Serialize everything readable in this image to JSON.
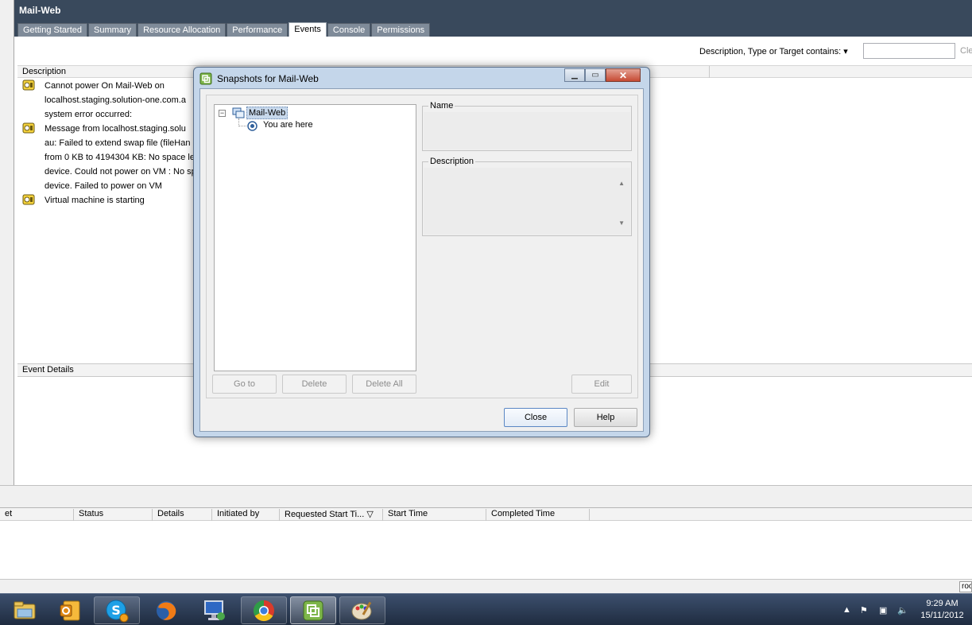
{
  "window": {
    "title": "Mail-Web",
    "tabs": [
      {
        "label": "Getting Started",
        "active": false
      },
      {
        "label": "Summary",
        "active": false
      },
      {
        "label": "Resource Allocation",
        "active": false
      },
      {
        "label": "Performance",
        "active": false
      },
      {
        "label": "Events",
        "active": true
      },
      {
        "label": "Console",
        "active": false
      },
      {
        "label": "Permissions",
        "active": false
      }
    ]
  },
  "filter": {
    "label": "Description, Type or Target contains: ▾",
    "value": "",
    "clear_label": "Cle"
  },
  "events": {
    "column_header": "Description",
    "items": [
      {
        "lines": [
          "Cannot power On Mail-Web on",
          "localhost.staging.solution-one.com.a",
          "system error occurred:"
        ]
      },
      {
        "lines": [
          "Message from localhost.staging.solu",
          "au: Failed to extend swap file (fileHan",
          "from 0 KB to 4194304 KB: No space le",
          "device. Could not power on VM : No sp",
          "device. Failed to power on VM"
        ]
      },
      {
        "lines": [
          "Virtual machine is starting"
        ]
      }
    ]
  },
  "event_details": {
    "header": "Event Details"
  },
  "tasks": {
    "columns": [
      "et",
      "Status",
      "Details",
      "Initiated by",
      "Requested Start Ti... ▽",
      "Start Time",
      "Completed Time"
    ]
  },
  "status_bar": {
    "user": "roo"
  },
  "dialog": {
    "title": "Snapshots for Mail-Web",
    "tree": {
      "root": "Mail-Web",
      "toggle": "−",
      "child": "You are here"
    },
    "name_label": "Name",
    "name_value": "",
    "description_label": "Description",
    "description_value": "",
    "buttons": {
      "go_to": "Go to",
      "delete": "Delete",
      "delete_all": "Delete All",
      "edit": "Edit",
      "close": "Close",
      "help": "Help"
    }
  },
  "taskbar": {
    "items": [
      "file-explorer-icon",
      "outlook-icon",
      "skype-icon",
      "firefox-icon",
      "remote-desktop-icon",
      "chrome-icon",
      "vsphere-client-icon",
      "paint-icon"
    ]
  },
  "clock": {
    "time": "9:29 AM",
    "date": "15/11/2012"
  },
  "colors": {
    "header": "#39495c",
    "dialog_frame": "#c4d6ea",
    "taskbar": "#1f2c40"
  }
}
